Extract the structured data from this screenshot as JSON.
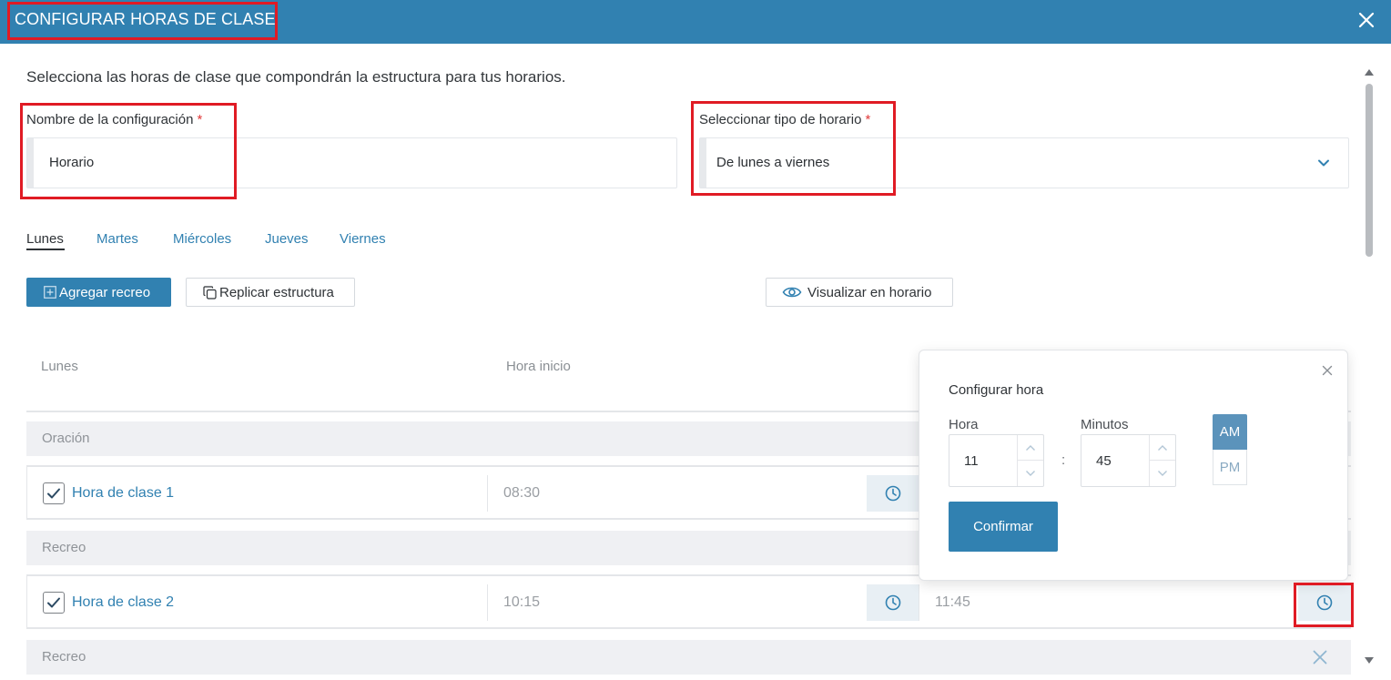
{
  "header": {
    "title": "CONFIGURAR HORAS DE CLASE"
  },
  "intro": "Selecciona las horas de clase que compondrán la estructura para tus horarios.",
  "form": {
    "name_label": "Nombre de la configuración",
    "name_value": "Horario",
    "type_label": "Seleccionar tipo de horario",
    "type_value": "De lunes a viernes",
    "required_mark": "*"
  },
  "tabs": [
    "Lunes",
    "Martes",
    "Miércoles",
    "Jueves",
    "Viernes"
  ],
  "actions": {
    "add_break": "Agregar recreo",
    "replicate": "Replicar estructura",
    "preview": "Visualizar en horario"
  },
  "table": {
    "headers": {
      "day": "Lunes",
      "start": "Hora inicio"
    },
    "rows": [
      {
        "type": "break",
        "label": "Oración"
      },
      {
        "type": "class",
        "label": "Hora de clase 1",
        "start": "08:30",
        "checked": true
      },
      {
        "type": "break",
        "label": "Recreo"
      },
      {
        "type": "class",
        "label": "Hora de clase 2",
        "start": "10:15",
        "end": "11:45",
        "checked": true
      },
      {
        "type": "break",
        "label": "Recreo"
      }
    ]
  },
  "time_popover": {
    "title": "Configurar hora",
    "hour_label": "Hora",
    "hour_value": "11",
    "minutes_label": "Minutos",
    "minutes_value": "45",
    "separator": ":",
    "am": "AM",
    "pm": "PM",
    "selected_period": "AM",
    "confirm": "Confirmar"
  },
  "colors": {
    "primary": "#3181b1",
    "highlight": "#e01b24",
    "row_grey": "#eff0f3"
  }
}
